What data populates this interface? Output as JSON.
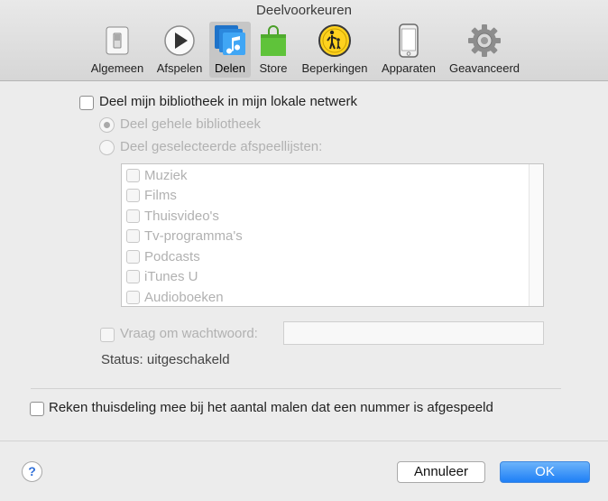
{
  "window": {
    "title": "Deelvoorkeuren"
  },
  "toolbar": {
    "items": [
      {
        "label": "Algemeen",
        "icon": "general-switch-icon"
      },
      {
        "label": "Afspelen",
        "icon": "play-icon"
      },
      {
        "label": "Delen",
        "icon": "share-music-icon",
        "active": true
      },
      {
        "label": "Store",
        "icon": "shopping-bag-icon"
      },
      {
        "label": "Beperkingen",
        "icon": "parental-controls-icon"
      },
      {
        "label": "Apparaten",
        "icon": "iphone-icon"
      },
      {
        "label": "Geavanceerd",
        "icon": "gear-icon"
      }
    ]
  },
  "sharing": {
    "share_library_label": "Deel mijn bibliotheek in mijn lokale netwerk",
    "share_all_label": "Deel gehele bibliotheek",
    "share_selected_label": "Deel geselecteerde afspeellijsten:",
    "playlists": [
      "Muziek",
      "Films",
      "Thuisvideo's",
      "Tv-programma's",
      "Podcasts",
      "iTunes U",
      "Audioboeken"
    ],
    "password_label": "Vraag om wachtwoord:",
    "password_value": "",
    "status_text": "Status: uitgeschakeld",
    "home_sharing_label": "Reken thuisdeling mee bij het aantal malen dat een nummer is afgespeeld"
  },
  "footer": {
    "help_label": "?",
    "cancel_label": "Annuleer",
    "ok_label": "OK"
  },
  "colors": {
    "accent": "#1e7ff6",
    "disabled_text": "#b1b1b1"
  }
}
